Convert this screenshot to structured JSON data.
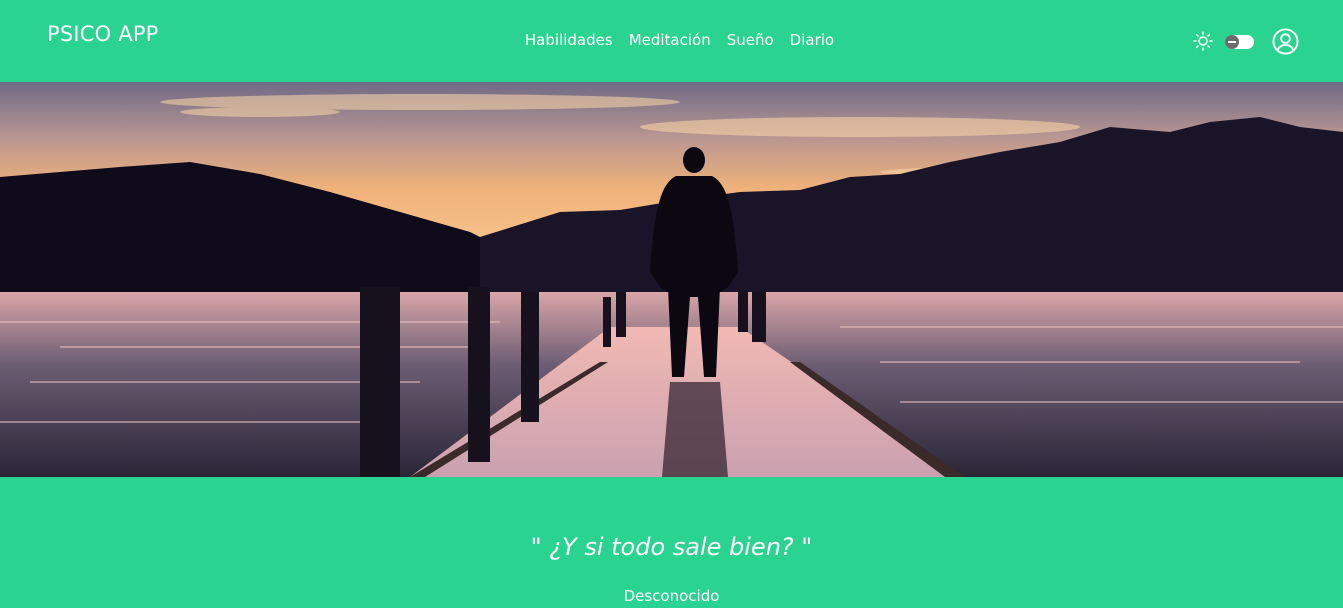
{
  "brand": "PSICO APP",
  "nav": {
    "links": [
      "Habilidades",
      "Meditación",
      "Sueño",
      "Diario"
    ]
  },
  "header_icons": {
    "theme_icon": "sun-icon",
    "theme_toggle": "theme-toggle",
    "account_icon": "user-circle-icon"
  },
  "hero": {
    "image": "silhouette of person standing on a pier at sunset over a lake with mountains"
  },
  "quote": {
    "text": "\" ¿Y si todo sale bien? \"",
    "author": "Desconocido"
  },
  "colors": {
    "brand_green": "#2bd391",
    "text": "#ffffff"
  }
}
